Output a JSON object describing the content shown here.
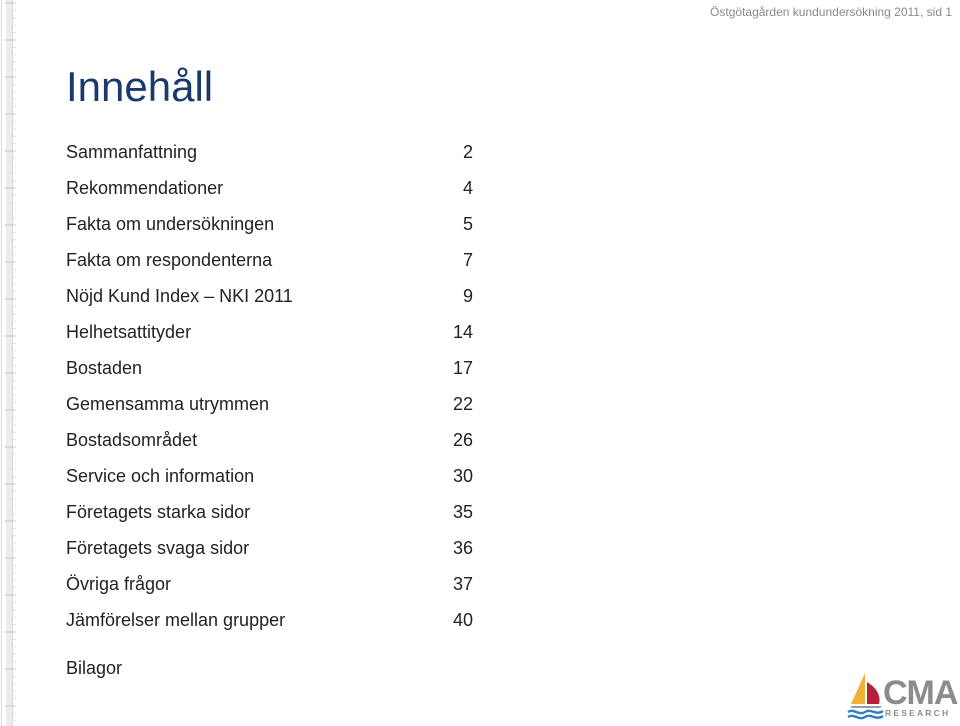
{
  "header": {
    "running_title": "Östgötagården kundundersökning 2011,  sid 1"
  },
  "page": {
    "title": "Innehåll"
  },
  "toc": {
    "items": [
      {
        "label": "Sammanfattning",
        "page": "2"
      },
      {
        "label": "Rekommendationer",
        "page": "4"
      },
      {
        "label": "Fakta om undersökningen",
        "page": "5"
      },
      {
        "label": "Fakta om respondenterna",
        "page": "7"
      },
      {
        "label": "Nöjd Kund Index – NKI 2011",
        "page": "9"
      },
      {
        "label": "Helhetsattityder",
        "page": "14"
      },
      {
        "label": "Bostaden",
        "page": "17"
      },
      {
        "label": "Gemensamma utrymmen",
        "page": "22"
      },
      {
        "label": "Bostadsområdet",
        "page": "26"
      },
      {
        "label": "Service och information",
        "page": "30"
      },
      {
        "label": "Företagets starka sidor",
        "page": "35"
      },
      {
        "label": "Företagets svaga sidor",
        "page": "36"
      },
      {
        "label": "Övriga frågor",
        "page": "37"
      },
      {
        "label": "Jämförelser mellan grupper",
        "page": "40"
      }
    ],
    "appendix_label": "Bilagor"
  },
  "logo": {
    "name": "CMA",
    "subtitle": "RESEARCH",
    "icon": "sailboat-icon",
    "colors": {
      "sail_left": "#f0b33a",
      "sail_right": "#b3203a",
      "waves": "#2f7fc1",
      "text": "#8c8c8c"
    }
  },
  "colors": {
    "title": "#1b3a6b",
    "body_text": "#222222",
    "header_text": "#8a8a8a"
  }
}
